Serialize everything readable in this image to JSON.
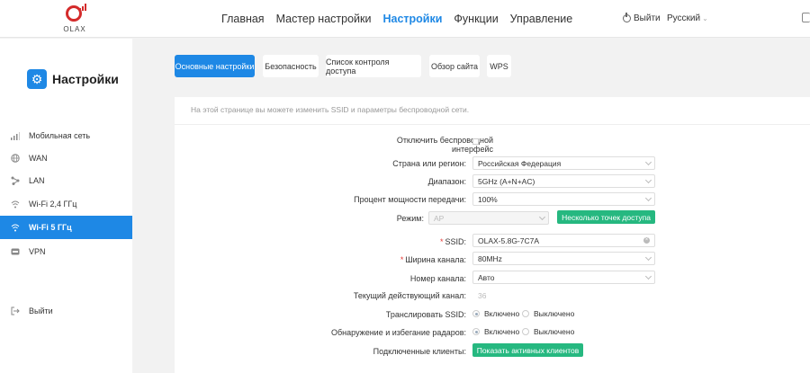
{
  "header": {
    "logo_text": "OLAX",
    "nav": [
      "Главная",
      "Мастер настройки",
      "Настройки",
      "Функции",
      "Управление"
    ],
    "active_nav": "Настройки",
    "logout": "Выйти",
    "language": "Русский"
  },
  "sidebar": {
    "title": "Настройки",
    "items": [
      {
        "label": "Мобильная сеть",
        "icon": "signal-icon"
      },
      {
        "label": "WAN",
        "icon": "globe-icon"
      },
      {
        "label": "LAN",
        "icon": "lan-icon"
      },
      {
        "label": "Wi-Fi 2,4 ГГц",
        "icon": "wifi-icon"
      },
      {
        "label": "Wi-Fi 5 ГГц",
        "icon": "wifi-icon"
      },
      {
        "label": "VPN",
        "icon": "vpn-icon"
      }
    ],
    "active_item": "Wi-Fi 5 ГГц",
    "logout": "Выйти"
  },
  "tabs": [
    "Основные настройки",
    "Безопасность",
    "Список контроля доступа",
    "Обзор сайта",
    "WPS"
  ],
  "active_tab": "Основные настройки",
  "panel": {
    "description": "На этой странице вы можете изменить SSID и параметры беспроводной сети.",
    "disable_label_1": "Отключить беспроводной",
    "disable_label_2": "интерфейс",
    "country_label": "Страна или регион:",
    "country_value": "Российская Федерация",
    "band_label": "Диапазон:",
    "band_value": "5GHz (A+N+AC)",
    "power_label": "Процент мощности передачи:",
    "power_value": "100%",
    "mode_label": "Режим:",
    "mode_value": "AP",
    "multi_ap_button": "Несколько точек доступа",
    "ssid_label": "SSID:",
    "ssid_value": "OLAX-5.8G-7C7A",
    "width_label": "Ширина канала:",
    "width_value": "80MHz",
    "channel_label": "Номер канала:",
    "channel_value": "Авто",
    "current_channel_label": "Текущий действующий канал:",
    "current_channel_value": "36",
    "broadcast_label": "Транслировать SSID:",
    "on": "Включено",
    "off": "Выключено",
    "radar_label": "Обнаружение и избегание радаров:",
    "clients_label": "Подключенные клиенты:",
    "clients_button": "Показать активных клиентов"
  },
  "colors": {
    "accent": "#1e88e5",
    "green": "#26b880",
    "brand_red": "#d42b2b"
  }
}
